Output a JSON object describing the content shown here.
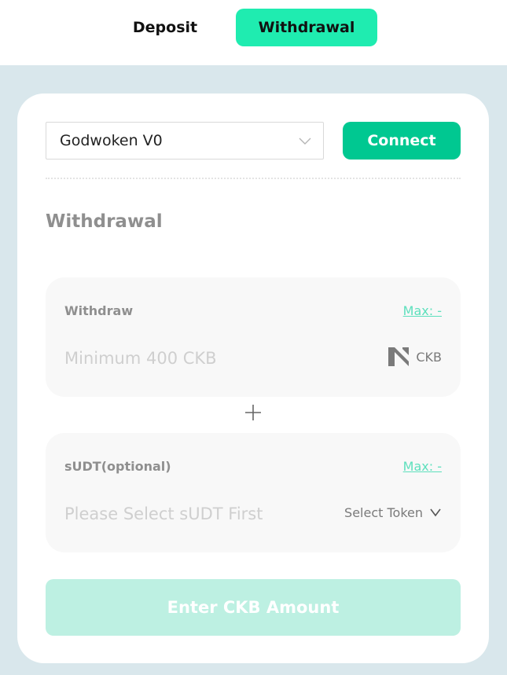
{
  "tabs": {
    "deposit": "Deposit",
    "withdrawal": "Withdrawal"
  },
  "network": {
    "selected": "Godwoken V0"
  },
  "connect_label": "Connect",
  "section_title": "Withdrawal",
  "withdraw_box": {
    "label": "Withdraw",
    "max": "Max: -",
    "placeholder": "Minimum 400 CKB",
    "token": "CKB",
    "token_icon": "nervos-ckb-logo"
  },
  "sudt_box": {
    "label": "sUDT(optional)",
    "max": "Max: -",
    "placeholder": "Please Select sUDT First",
    "select_token": "Select Token"
  },
  "submit_label": "Enter CKB Amount",
  "colors": {
    "accent": "#1fecb0",
    "connect": "#00c891",
    "submit_disabled": "#bdf0e2",
    "max_link": "#5ee0bd",
    "background": "#d9e7ec"
  }
}
